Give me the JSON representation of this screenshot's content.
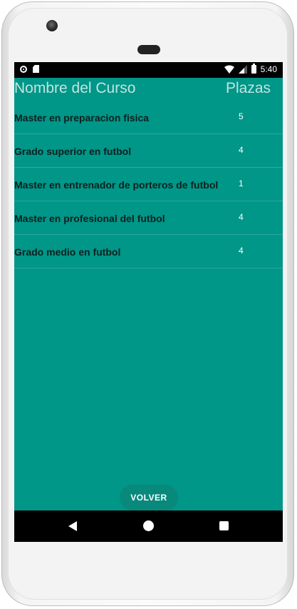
{
  "statusbar": {
    "time": "5:40",
    "icons": [
      "circle-status-icon",
      "sd-card-icon",
      "wifi-icon",
      "signal-icon",
      "battery-icon"
    ]
  },
  "header": {
    "course_label": "Nombre del Curso",
    "places_label": "Plazas"
  },
  "courses": [
    {
      "name": "Master en preparacion fisica",
      "places": "5"
    },
    {
      "name": "Grado superior en futbol",
      "places": "4"
    },
    {
      "name": "Master en entrenador de porteros de futbol",
      "places": "1"
    },
    {
      "name": "Master en profesional del futbol",
      "places": "4"
    },
    {
      "name": "Grado medio en futbol",
      "places": "4"
    }
  ],
  "actions": {
    "back_label": "VOLVER"
  },
  "colors": {
    "screen_bg": "#009688",
    "button_bg": "#08897c",
    "header_text": "#bfe6e1",
    "row_text": "#0f1f1e"
  }
}
